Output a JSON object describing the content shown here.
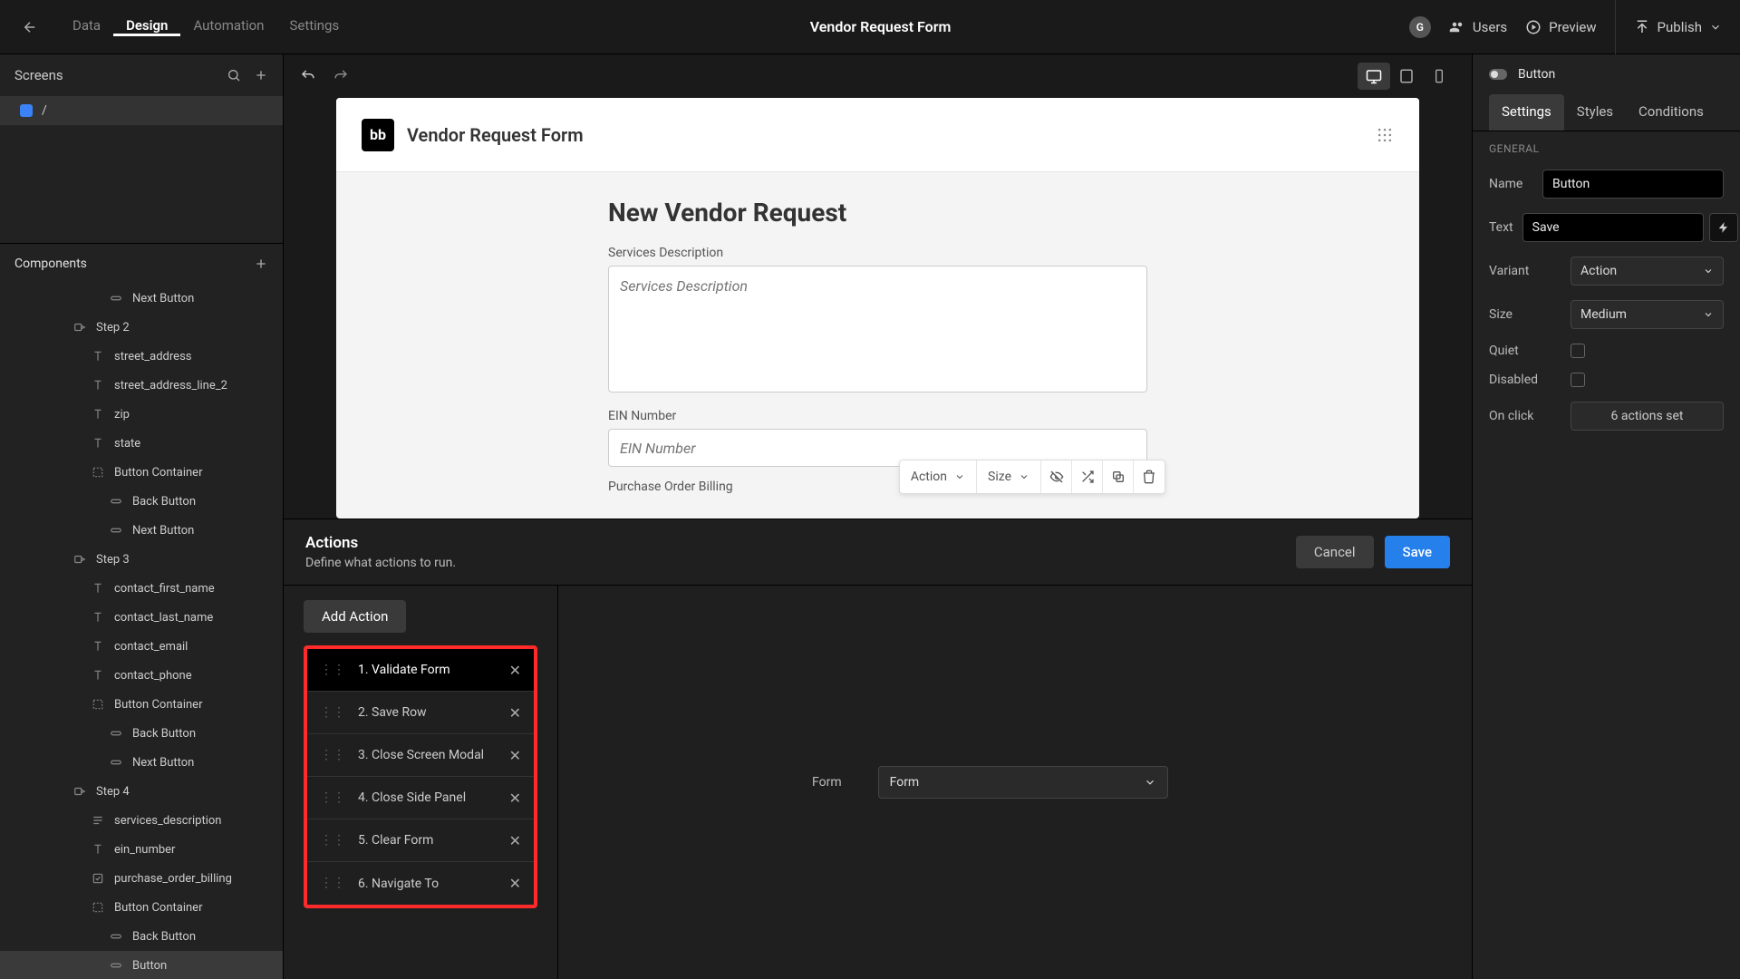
{
  "topnav": {
    "tabs": [
      "Data",
      "Design",
      "Automation",
      "Settings"
    ],
    "active_tab": "Design",
    "title": "Vendor Request Form",
    "avatar": "G",
    "users": "Users",
    "preview": "Preview",
    "publish": "Publish"
  },
  "left": {
    "screens_title": "Screens",
    "screen_name": "/",
    "components_title": "Components",
    "tree": [
      {
        "type": "pill",
        "label": "Next Button",
        "indent": 3
      },
      {
        "type": "step",
        "label": "Step 2",
        "indent": 1
      },
      {
        "type": "text",
        "label": "street_address",
        "indent": 2
      },
      {
        "type": "text",
        "label": "street_address_line_2",
        "indent": 2
      },
      {
        "type": "text",
        "label": "zip",
        "indent": 2
      },
      {
        "type": "text",
        "label": "state",
        "indent": 2
      },
      {
        "type": "box",
        "label": "Button Container",
        "indent": 2
      },
      {
        "type": "pill",
        "label": "Back Button",
        "indent": 3
      },
      {
        "type": "pill",
        "label": "Next Button",
        "indent": 3
      },
      {
        "type": "step",
        "label": "Step 3",
        "indent": 1
      },
      {
        "type": "text",
        "label": "contact_first_name",
        "indent": 2
      },
      {
        "type": "text",
        "label": "contact_last_name",
        "indent": 2
      },
      {
        "type": "text",
        "label": "contact_email",
        "indent": 2
      },
      {
        "type": "text",
        "label": "contact_phone",
        "indent": 2
      },
      {
        "type": "box",
        "label": "Button Container",
        "indent": 2
      },
      {
        "type": "pill",
        "label": "Back Button",
        "indent": 3
      },
      {
        "type": "pill",
        "label": "Next Button",
        "indent": 3
      },
      {
        "type": "step",
        "label": "Step 4",
        "indent": 1
      },
      {
        "type": "para",
        "label": "services_description",
        "indent": 2
      },
      {
        "type": "text",
        "label": "ein_number",
        "indent": 2
      },
      {
        "type": "check",
        "label": "purchase_order_billing",
        "indent": 2
      },
      {
        "type": "box",
        "label": "Button Container",
        "indent": 2
      },
      {
        "type": "pill",
        "label": "Back Button",
        "indent": 3
      },
      {
        "type": "pill",
        "label": "Button",
        "indent": 3,
        "selected": true
      }
    ]
  },
  "canvas": {
    "brand_logo": "bb",
    "brand_title": "Vendor Request Form",
    "form_title": "New Vendor Request",
    "fields": {
      "services_desc_label": "Services Description",
      "services_desc_placeholder": "Services Description",
      "ein_label": "EIN Number",
      "ein_placeholder": "EIN Number",
      "pob_label": "Purchase Order Billing"
    },
    "sel_toolbar": {
      "action": "Action",
      "size": "Size"
    }
  },
  "actions": {
    "title": "Actions",
    "subtitle": "Define what actions to run.",
    "cancel": "Cancel",
    "save": "Save",
    "add_action": "Add Action",
    "list": [
      "1. Validate Form",
      "2. Save Row",
      "3. Close Screen Modal",
      "4. Close Side Panel",
      "5. Clear Form",
      "6. Navigate To"
    ],
    "active_index": 0,
    "form_label": "Form",
    "form_value": "Form"
  },
  "right": {
    "component_label": "Button",
    "tabs": [
      "Settings",
      "Styles",
      "Conditions"
    ],
    "active_tab": "Settings",
    "section": "GENERAL",
    "name_label": "Name",
    "name_value": "Button",
    "text_label": "Text",
    "text_value": "Save",
    "variant_label": "Variant",
    "variant_value": "Action",
    "size_label": "Size",
    "size_value": "Medium",
    "quiet_label": "Quiet",
    "disabled_label": "Disabled",
    "onclick_label": "On click",
    "onclick_value": "6 actions set"
  }
}
